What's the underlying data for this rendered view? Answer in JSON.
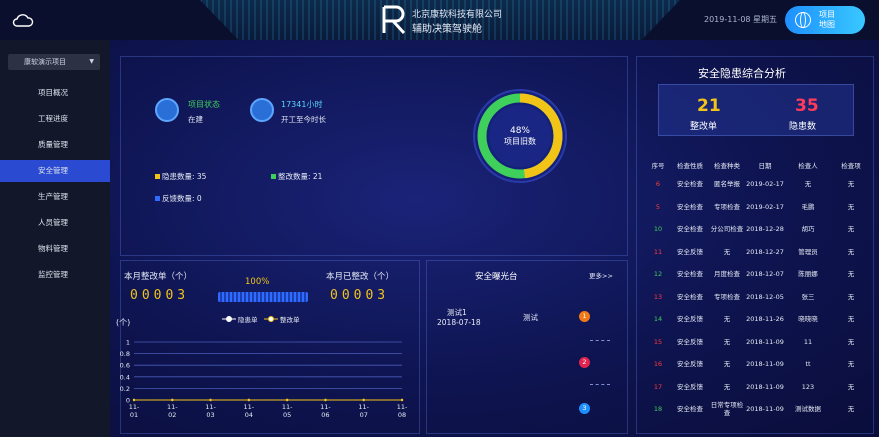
{
  "header": {
    "company": "北京康软科技有限公司",
    "app_title": "辅助决策驾驶舱",
    "datetime": "2019-11-08 星期五",
    "map_button": "项目 地图"
  },
  "sidebar": {
    "project_select": "康软演示项目",
    "items": [
      {
        "label": "项目概况"
      },
      {
        "label": "工程进度"
      },
      {
        "label": "质量管理"
      },
      {
        "label": "安全管理",
        "active": true
      },
      {
        "label": "生产管理"
      },
      {
        "label": "人员管理"
      },
      {
        "label": "物料管理"
      },
      {
        "label": "监控管理"
      }
    ]
  },
  "project": {
    "status_title": "项目状态",
    "status_value": "在建",
    "hours_title": "17341小时",
    "hours_sub": "开工至今时长"
  },
  "counts": {
    "hazard_label": "隐患数量: 35",
    "rectify_label": "整改数量: 21",
    "feedback_label": "反馈数量: 0"
  },
  "donut": {
    "percent": "48%",
    "label": "项目旧数",
    "fraction": 0.48
  },
  "monthly": {
    "rectify_label": "本月整改单（个）",
    "rectify_value": "00003",
    "progress_label": "100%",
    "done_label": "本月已整改（个）",
    "done_value": "00003"
  },
  "colors": {
    "hazard": "#f2c418",
    "rectify": "#3fcf5b",
    "feedback": "#2f6bff",
    "active_menu": "#2a4bd1"
  },
  "chart_data": {
    "type": "line",
    "ylabel": "(个)",
    "categories": [
      "11-01",
      "11-02",
      "11-03",
      "11-04",
      "11-05",
      "11-06",
      "11-07",
      "11-08"
    ],
    "series": [
      {
        "name": "隐患单",
        "values": [
          0,
          0,
          0,
          0,
          0,
          0,
          0,
          0
        ]
      },
      {
        "name": "整改单",
        "values": [
          0,
          0,
          0,
          0,
          0,
          0,
          0,
          0
        ]
      }
    ],
    "y_ticks": [
      "1",
      "0.8",
      "0.6",
      "0.4",
      "0.2",
      "0"
    ],
    "ylim": [
      0,
      1
    ]
  },
  "analysis": {
    "title": "安全隐患综合分析",
    "rectify_count": "21",
    "rectify_label": "整改单",
    "hazard_count": "35",
    "hazard_label": "隐患数",
    "columns": [
      "序号",
      "检查性质",
      "检查种类",
      "日期",
      "检查人",
      "检查项"
    ],
    "rows": [
      [
        "6",
        "安全检查",
        "匿名举报",
        "2019-02-17",
        "无",
        "无"
      ],
      [
        "5",
        "安全检查",
        "专项检查",
        "2019-02-17",
        "毛鹏",
        "无"
      ],
      [
        "10",
        "安全检查",
        "分公司检查",
        "2018-12-28",
        "胡巧",
        "无"
      ],
      [
        "11",
        "安全反馈",
        "无",
        "2018-12-27",
        "管理员",
        "无"
      ],
      [
        "12",
        "安全检查",
        "月度检查",
        "2018-12-07",
        "陈丽娜",
        "无"
      ],
      [
        "13",
        "安全检查",
        "专项检查",
        "2018-12-05",
        "张三",
        "无"
      ],
      [
        "14",
        "安全反馈",
        "无",
        "2018-11-26",
        "晓晓晓",
        "无"
      ],
      [
        "15",
        "安全反馈",
        "无",
        "2018-11-09",
        "11",
        "无"
      ],
      [
        "16",
        "安全反馈",
        "无",
        "2018-11-09",
        "tt",
        "无"
      ],
      [
        "17",
        "安全反馈",
        "无",
        "2018-11-09",
        "123",
        "无"
      ],
      [
        "18",
        "安全检查",
        "日常专项检查",
        "2018-11-09",
        "测试数据",
        "无"
      ]
    ]
  },
  "exposure": {
    "title": "安全曝光台",
    "more": "更多>>",
    "item_name": "测试1",
    "item_date": "2018-07-18",
    "item_text": "测试",
    "badges": [
      "1",
      "2",
      "3"
    ]
  }
}
